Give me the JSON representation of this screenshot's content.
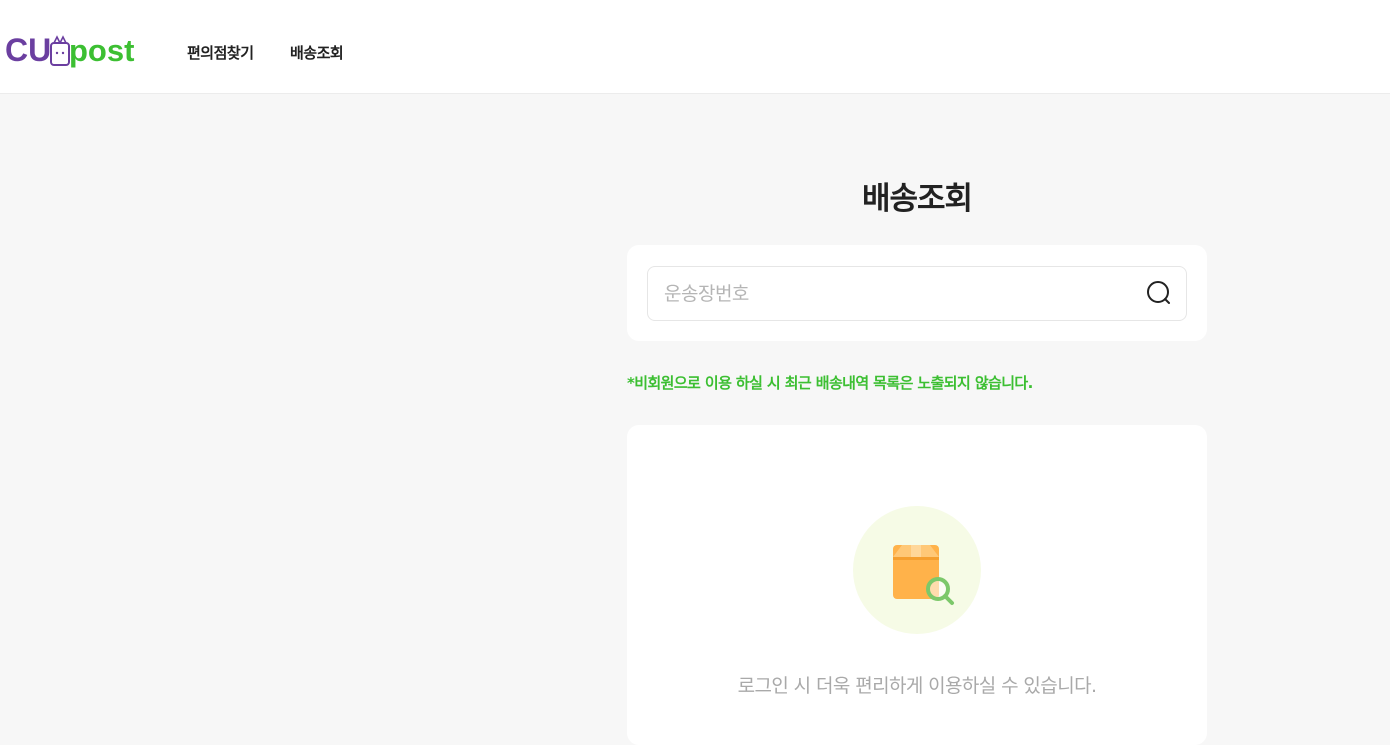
{
  "header": {
    "logo_text": "CUpost",
    "nav": [
      {
        "label": "편의점찾기"
      },
      {
        "label": "배송조회"
      }
    ]
  },
  "main": {
    "title": "배송조회",
    "search": {
      "placeholder": "운송장번호",
      "value": "",
      "icon": "search-icon"
    },
    "notice": "*비회원으로 이용 하실 시 최근 배송내역 목록은 노출되지 않습니다.",
    "empty_state": {
      "icon": "package-search-icon",
      "message": "로그인 시 더욱 편리하게 이용하실 수 있습니다."
    }
  },
  "colors": {
    "brand_purple": "#6b3fa0",
    "brand_green": "#3cbf32",
    "background": "#f7f7f7",
    "illustration_bg": "#f6fbe6",
    "box_orange": "#ffb24a"
  }
}
